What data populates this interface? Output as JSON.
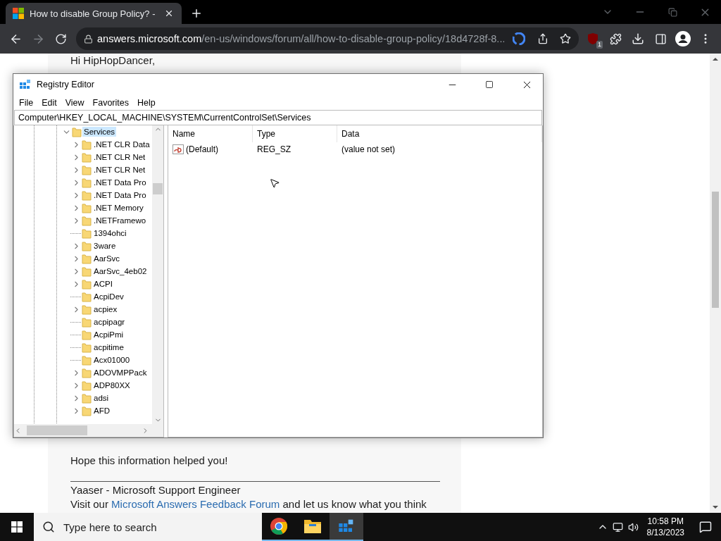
{
  "browser": {
    "tab": {
      "title": "How to disable Group Policy? -",
      "selected": true
    },
    "nav": {
      "forward_disabled": true
    },
    "address": {
      "host": "answers.microsoft.com",
      "path": "/en-us/windows/forum/all/how-to-disable-group-policy/18d4728f-8..."
    },
    "extension_badge": "1"
  },
  "page": {
    "greeting": "Hi HipHopDancer,",
    "closing": "Hope this information helped you!",
    "signature": "Yaaser - Microsoft Support Engineer",
    "feedback": {
      "before": "Visit our",
      "link": "Microsoft Answers Feedback Forum",
      "after": "and let us know what you think"
    }
  },
  "registry_editor": {
    "title": "Registry Editor",
    "menu": [
      "File",
      "Edit",
      "View",
      "Favorites",
      "Help"
    ],
    "path": "Computer\\HKEY_LOCAL_MACHINE\\SYSTEM\\CurrentControlSet\\Services",
    "tree": [
      {
        "label": "Services",
        "expanded": true,
        "selected": true,
        "children": [
          {
            "label": ".NET CLR Data",
            "expandable": true
          },
          {
            "label": ".NET CLR Net",
            "expandable": true
          },
          {
            "label": ".NET CLR Net",
            "expandable": true
          },
          {
            "label": ".NET Data Pro",
            "expandable": true
          },
          {
            "label": ".NET Data Pro",
            "expandable": true
          },
          {
            "label": ".NET Memory",
            "expandable": true
          },
          {
            "label": ".NETFramewo",
            "expandable": true
          },
          {
            "label": "1394ohci",
            "expandable": false
          },
          {
            "label": "3ware",
            "expandable": true
          },
          {
            "label": "AarSvc",
            "expandable": true
          },
          {
            "label": "AarSvc_4eb02",
            "expandable": true
          },
          {
            "label": "ACPI",
            "expandable": true
          },
          {
            "label": "AcpiDev",
            "expandable": false
          },
          {
            "label": "acpiex",
            "expandable": true
          },
          {
            "label": "acpipagr",
            "expandable": false
          },
          {
            "label": "AcpiPmi",
            "expandable": false
          },
          {
            "label": "acpitime",
            "expandable": false
          },
          {
            "label": "Acx01000",
            "expandable": false
          },
          {
            "label": "ADOVMPPack",
            "expandable": true
          },
          {
            "label": "ADP80XX",
            "expandable": true
          },
          {
            "label": "adsi",
            "expandable": true
          },
          {
            "label": "AFD",
            "expandable": true
          }
        ]
      }
    ],
    "columns": [
      "Name",
      "Type",
      "Data"
    ],
    "values": [
      {
        "name": "(Default)",
        "type": "REG_SZ",
        "data": "(value not set)"
      }
    ]
  },
  "taskbar": {
    "search_placeholder": "Type here to search",
    "apps": [
      {
        "kind": "chrome",
        "selected": false
      },
      {
        "kind": "explorer",
        "selected": false
      },
      {
        "kind": "regedit",
        "selected": true
      }
    ],
    "time": "10:58 PM",
    "date": "8/13/2023"
  }
}
